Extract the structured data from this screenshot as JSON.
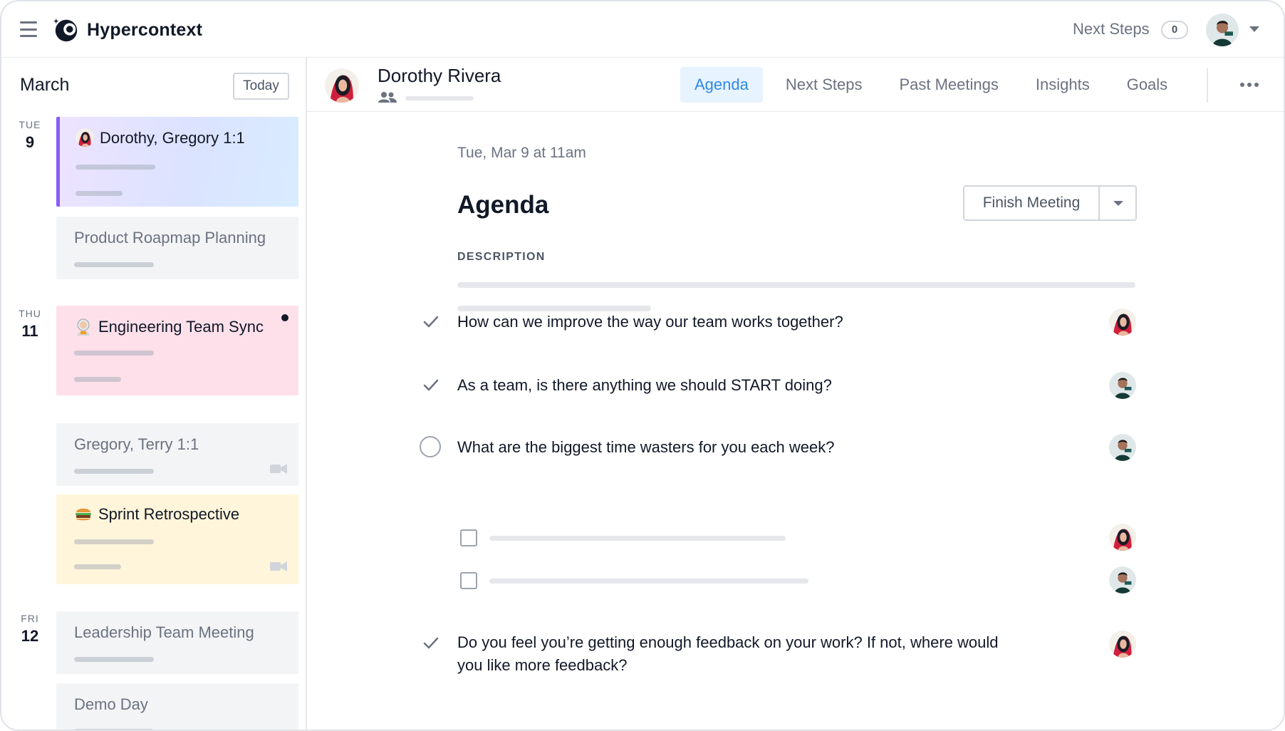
{
  "app": {
    "name": "Hypercontext"
  },
  "topbar": {
    "next_steps_label": "Next Steps",
    "next_steps_count": "0"
  },
  "sidebar": {
    "month": "March",
    "today_label": "Today",
    "days": [
      {
        "dow": "TUE",
        "num": "9"
      },
      {
        "dow": "THU",
        "num": "11"
      },
      {
        "dow": "FRI",
        "num": "12"
      }
    ],
    "meetings": [
      {
        "title": "Dorothy, Gregory 1:1"
      },
      {
        "title": "Product Roapmap Planning"
      },
      {
        "title": "Engineering Team Sync"
      },
      {
        "title": "Gregory, Terry 1:1"
      },
      {
        "title": "Sprint Retrospective"
      },
      {
        "title": "Leadership Team Meeting"
      },
      {
        "title": "Demo Day"
      }
    ]
  },
  "header": {
    "person_name": "Dorothy Rivera",
    "tabs": [
      "Agenda",
      "Next Steps",
      "Past Meetings",
      "Insights",
      "Goals"
    ]
  },
  "agenda": {
    "date": "Tue, Mar 9 at 11am",
    "title": "Agenda",
    "finish_label": "Finish Meeting",
    "description_label": "DESCRIPTION",
    "items": [
      {
        "text": "How can we improve the way our team works together?",
        "status": "done"
      },
      {
        "text": "As a team, is there anything we should START doing?",
        "status": "done"
      },
      {
        "text": "What are the biggest time wasters for you each week?",
        "status": "open"
      },
      {
        "text": "Do you feel you’re getting enough feedback on your work? If not, where would you like more feedback?",
        "status": "done"
      }
    ]
  },
  "colors": {
    "accent": "#2e8ae6",
    "active_tab_bg": "#e7f3fe",
    "card_active_border": "#8b5cf6",
    "card_pink": "#fde0ea",
    "card_yellow": "#fff5da"
  }
}
